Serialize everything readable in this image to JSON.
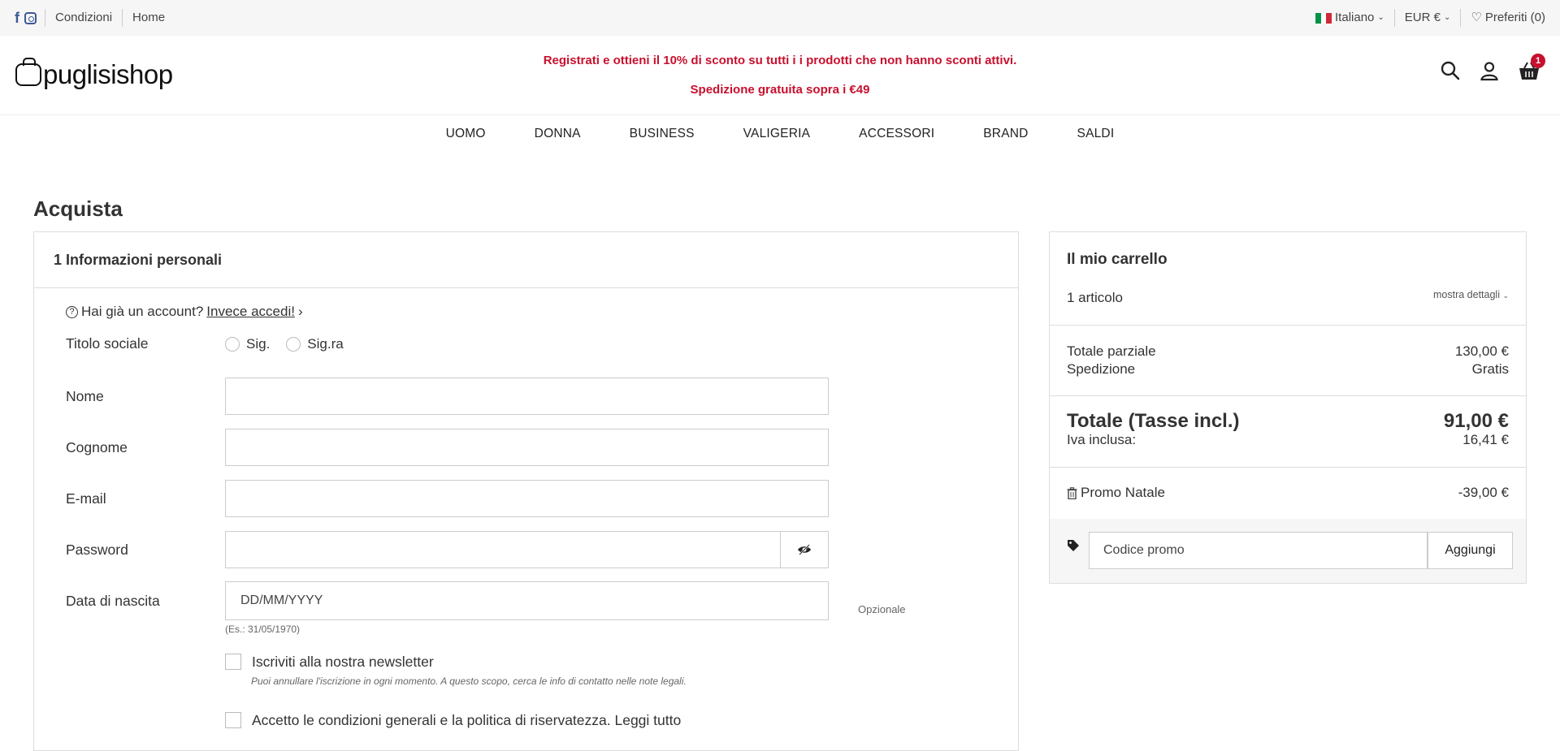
{
  "topbar": {
    "links": [
      "Condizioni",
      "Home"
    ],
    "language": "Italiano",
    "currency": "EUR €",
    "favorites": "Preferiti (0)"
  },
  "header": {
    "logo": "puglisishop",
    "promo_line1": "Registrati e ottieni il 10% di sconto su tutti i i prodotti che non hanno sconti attivi.",
    "promo_line2": "Spedizione gratuita sopra i €49",
    "cart_badge": "1"
  },
  "nav": [
    "UOMO",
    "DONNA",
    "BUSINESS",
    "VALIGERIA",
    "ACCESSORI",
    "BRAND",
    "SALDI"
  ],
  "page": {
    "title": "Acquista"
  },
  "checkout": {
    "step_title": "1 Informazioni personali",
    "account_question": "Hai già un account?",
    "login_link": "Invece accedi!",
    "social_title_label": "Titolo sociale",
    "social_title_options": [
      "Sig.",
      "Sig.ra"
    ],
    "name_label": "Nome",
    "surname_label": "Cognome",
    "email_label": "E-mail",
    "password_label": "Password",
    "birthdate_label": "Data di nascita",
    "birthdate_placeholder": "DD/MM/YYYY",
    "birthdate_hint": "(Es.: 31/05/1970)",
    "optional_label": "Opzionale",
    "newsletter_label": "Iscriviti alla nostra newsletter",
    "newsletter_note": "Puoi annullare l'iscrizione in ogni momento. A questo scopo, cerca le info di contatto nelle note legali.",
    "terms_label": "Accetto le condizioni generali e la politica di riservatezza. Leggi tutto"
  },
  "cart": {
    "title": "Il mio carrello",
    "count": "1 articolo",
    "details_toggle": "mostra dettagli",
    "subtotal_label": "Totale parziale",
    "subtotal_value": "130,00 €",
    "shipping_label": "Spedizione",
    "shipping_value": "Gratis",
    "total_label": "Totale (Tasse incl.)",
    "total_value": "91,00 €",
    "tax_label": "Iva inclusa:",
    "tax_value": "16,41 €",
    "voucher_name": "Promo Natale",
    "voucher_value": "-39,00 €",
    "promo_placeholder": "Codice promo",
    "promo_button": "Aggiungi"
  },
  "colors": {
    "accent_red": "#c8102e",
    "facebook_blue": "#3b5998"
  }
}
